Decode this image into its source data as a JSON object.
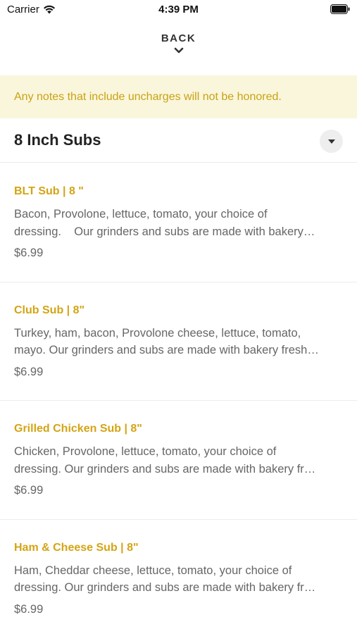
{
  "status_bar": {
    "carrier": "Carrier",
    "time": "4:39 PM",
    "wifi_icon": "wifi-icon",
    "battery_icon": "battery-icon"
  },
  "nav": {
    "back_label": "BACK",
    "back_icon": "chevron-down-icon"
  },
  "notice": {
    "text": "Any notes that include uncharges will not be honored.",
    "background_color": "#faf6dc",
    "text_color": "#c9a213"
  },
  "section": {
    "title": "8 Inch Subs",
    "dropdown_icon": "caret-down-icon"
  },
  "colors": {
    "accent": "#d4a414"
  },
  "items": [
    {
      "name": "BLT Sub | 8 \"",
      "desc_line1": "Bacon, Provolone, lettuce, tomato, your choice of",
      "desc_line2": "dressing.    Our grinders and subs are made with bakery…",
      "price": "$6.99"
    },
    {
      "name": "Club Sub | 8\"",
      "desc_line1": "Turkey, ham, bacon, Provolone cheese, lettuce, tomato,",
      "desc_line2": "mayo. Our grinders and subs are made with bakery fresh…",
      "price": "$6.99"
    },
    {
      "name": "Grilled Chicken Sub | 8\"",
      "desc_line1": "Chicken, Provolone, lettuce, tomato, your choice of",
      "desc_line2": "dressing. Our grinders and subs are made with bakery fr…",
      "price": "$6.99"
    },
    {
      "name": "Ham & Cheese Sub | 8\"",
      "desc_line1": "Ham, Cheddar cheese, lettuce, tomato, your choice of",
      "desc_line2": "dressing. Our grinders and subs are made with bakery fr…",
      "price": "$6.99"
    }
  ]
}
